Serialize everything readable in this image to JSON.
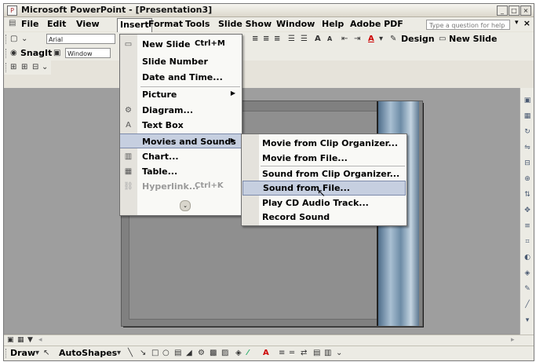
{
  "window": {
    "title": "Microsoft PowerPoint - [Presentation3]",
    "controls": [
      "_",
      "□",
      "×"
    ]
  },
  "menubar": {
    "items": [
      "File",
      "Edit",
      "View",
      "Insert",
      "Format",
      "Tools",
      "Slide Show",
      "Window",
      "Help",
      "Adobe PDF"
    ],
    "active": "Insert",
    "help_placeholder": "Type a question for help",
    "help_arrow": "▾",
    "close_glyph": "×"
  },
  "toolbar1": {
    "font_name": "Arial",
    "design_label": "Design",
    "new_slide_label": "New Slide"
  },
  "toolbar2": {
    "snagit_label": "SnagIt",
    "window_combo": "Window"
  },
  "insert_menu": {
    "items": [
      {
        "label": "New Slide",
        "shortcut": "Ctrl+M",
        "icon": "new-slide-icon",
        "glyph": "▭"
      },
      {
        "label": "Slide Number"
      },
      {
        "label": "Date and Time..."
      },
      {
        "label": "Picture",
        "submenu": true
      },
      {
        "label": "Diagram...",
        "icon": "diagram-icon",
        "glyph": "⚙"
      },
      {
        "label": "Text Box",
        "icon": "text-box-icon",
        "glyph": "A"
      },
      {
        "label": "Movies and Sounds",
        "submenu": true,
        "highlighted": true
      },
      {
        "label": "Chart...",
        "icon": "chart-icon",
        "glyph": "▥"
      },
      {
        "label": "Table...",
        "icon": "table-icon",
        "glyph": "▦"
      },
      {
        "label": "Hyperlink...",
        "shortcut": "Ctrl+K",
        "disabled": true,
        "icon": "hyperlink-icon",
        "glyph": "⛓"
      }
    ],
    "expand_glyph": "⌄"
  },
  "movies_submenu": {
    "items": [
      {
        "label": "Movie from Clip Organizer..."
      },
      {
        "label": "Movie from File..."
      },
      {
        "label": "Sound from Clip Organizer..."
      },
      {
        "label": "Sound from File...",
        "highlighted": true
      },
      {
        "label": "Play CD Audio Track..."
      },
      {
        "label": "Record Sound"
      }
    ]
  },
  "drawing_toolbar": {
    "draw_label": "Draw",
    "autoshapes_label": "AutoShapes"
  },
  "colors": {
    "menu_highlight": "#c6cfe0",
    "workspace": "#969696",
    "chrome": "#ecebe4"
  }
}
